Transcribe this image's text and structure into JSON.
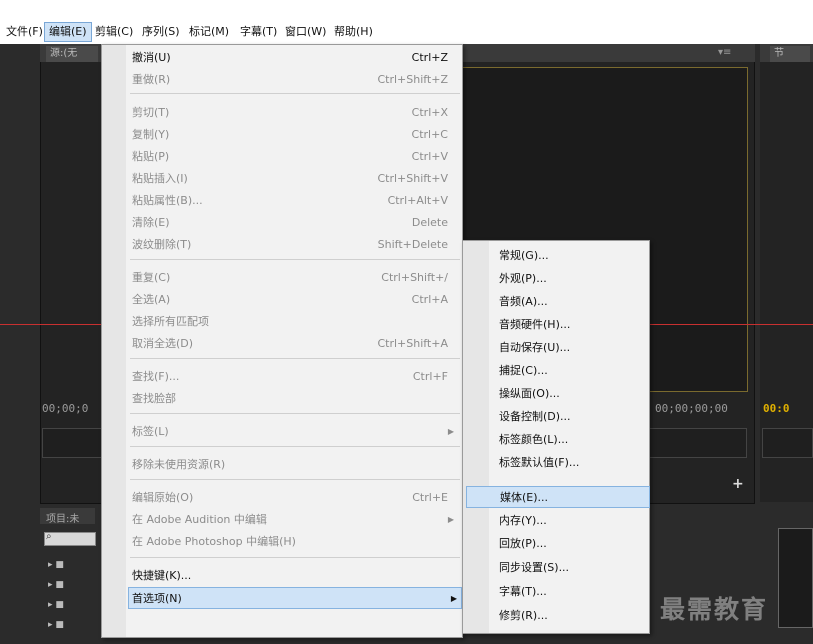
{
  "menubar": {
    "items": [
      {
        "label": "文件(F)"
      },
      {
        "label": "编辑(E)"
      },
      {
        "label": "剪辑(C)"
      },
      {
        "label": "序列(S)"
      },
      {
        "label": "标记(M)"
      },
      {
        "label": "字幕(T)"
      },
      {
        "label": "窗口(W)"
      },
      {
        "label": "帮助(H)"
      }
    ]
  },
  "background": {
    "source_tab": "源:(无",
    "program_tab": "节",
    "panel_menu_icon": "▾≡",
    "timecode_left": "00;00;0",
    "timecode_right": "00;00;00;00",
    "timecode_program": "00:0",
    "project_tab": "项目:未",
    "plus_icon": "+"
  },
  "edit_menu": {
    "items": [
      {
        "label": "撤消(U)",
        "shortcut": "Ctrl+Z",
        "enabled": true
      },
      {
        "label": "重做(R)",
        "shortcut": "Ctrl+Shift+Z",
        "enabled": false
      },
      {
        "label": "剪切(T)",
        "shortcut": "Ctrl+X",
        "enabled": false
      },
      {
        "label": "复制(Y)",
        "shortcut": "Ctrl+C",
        "enabled": false
      },
      {
        "label": "粘贴(P)",
        "shortcut": "Ctrl+V",
        "enabled": false
      },
      {
        "label": "粘贴插入(I)",
        "shortcut": "Ctrl+Shift+V",
        "enabled": false
      },
      {
        "label": "粘贴属性(B)...",
        "shortcut": "Ctrl+Alt+V",
        "enabled": false
      },
      {
        "label": "清除(E)",
        "shortcut": "Delete",
        "enabled": false
      },
      {
        "label": "波纹删除(T)",
        "shortcut": "Shift+Delete",
        "enabled": false
      },
      {
        "label": "重复(C)",
        "shortcut": "Ctrl+Shift+/",
        "enabled": false
      },
      {
        "label": "全选(A)",
        "shortcut": "Ctrl+A",
        "enabled": false
      },
      {
        "label": "选择所有匹配项",
        "shortcut": "",
        "enabled": false
      },
      {
        "label": "取消全选(D)",
        "shortcut": "Ctrl+Shift+A",
        "enabled": false
      },
      {
        "label": "查找(F)...",
        "shortcut": "Ctrl+F",
        "enabled": false
      },
      {
        "label": "查找脸部",
        "shortcut": "",
        "enabled": false
      },
      {
        "label": "标签(L)",
        "shortcut": "",
        "enabled": false
      },
      {
        "label": "移除未使用资源(R)",
        "shortcut": "",
        "enabled": false
      },
      {
        "label": "编辑原始(O)",
        "shortcut": "Ctrl+E",
        "enabled": false
      },
      {
        "label": "在 Adobe Audition 中编辑",
        "shortcut": "",
        "enabled": false
      },
      {
        "label": "在 Adobe Photoshop 中编辑(H)",
        "shortcut": "",
        "enabled": false
      },
      {
        "label": "快捷键(K)...",
        "shortcut": "",
        "enabled": true
      },
      {
        "label": "首选项(N)",
        "shortcut": "",
        "enabled": true
      }
    ]
  },
  "preferences_submenu": {
    "items": [
      {
        "label": "常规(G)..."
      },
      {
        "label": "外观(P)..."
      },
      {
        "label": "音频(A)..."
      },
      {
        "label": "音频硬件(H)..."
      },
      {
        "label": "自动保存(U)..."
      },
      {
        "label": "捕捉(C)..."
      },
      {
        "label": "操纵面(O)..."
      },
      {
        "label": "设备控制(D)..."
      },
      {
        "label": "标签颜色(L)..."
      },
      {
        "label": "标签默认值(F)..."
      },
      {
        "label": "媒体(E)..."
      },
      {
        "label": "内存(Y)..."
      },
      {
        "label": "回放(P)..."
      },
      {
        "label": "同步设置(S)..."
      },
      {
        "label": "字幕(T)..."
      },
      {
        "label": "修剪(R)..."
      }
    ],
    "highlighted_index": 10
  },
  "watermark": "最需教育"
}
